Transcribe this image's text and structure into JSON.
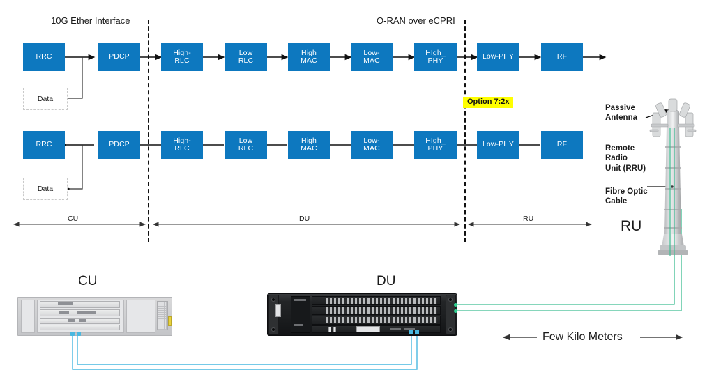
{
  "diagram": {
    "title_top_left": "10G Ether Interface",
    "title_top_right": "O-RAN over eCPRI",
    "split_marker_label": "Option 7:2x"
  },
  "downlink_chain": {
    "direction": "left-to-right",
    "blocks": [
      {
        "label": "RRC",
        "section": "CU"
      },
      {
        "label": "PDCP",
        "section": "CU"
      },
      {
        "label": "High-\nRLC",
        "section": "DU"
      },
      {
        "label": "Low\nRLC",
        "section": "DU"
      },
      {
        "label": "High\nMAC",
        "section": "DU"
      },
      {
        "label": "Low-\nMAC",
        "section": "DU"
      },
      {
        "label": "HIgh_\nPHY",
        "section": "DU"
      },
      {
        "label": "Low-PHY",
        "section": "RU"
      },
      {
        "label": "RF",
        "section": "RU"
      }
    ],
    "data_box": "Data"
  },
  "uplink_chain": {
    "direction": "right-to-left",
    "blocks": [
      {
        "label": "RRC",
        "section": "CU"
      },
      {
        "label": "PDCP",
        "section": "CU"
      },
      {
        "label": "High-\nRLC",
        "section": "DU"
      },
      {
        "label": "Low\nRLC",
        "section": "DU"
      },
      {
        "label": "High\nMAC",
        "section": "DU"
      },
      {
        "label": "Low-\nMAC",
        "section": "DU"
      },
      {
        "label": "HIgh_\nPHY",
        "section": "DU"
      },
      {
        "label": "Low-PHY",
        "section": "RU"
      },
      {
        "label": "RF",
        "section": "RU"
      }
    ],
    "data_box": "Data"
  },
  "scale_bar": {
    "segments": [
      {
        "label": "CU"
      },
      {
        "label": "DU"
      },
      {
        "label": "RU"
      }
    ]
  },
  "tower": {
    "callouts": [
      {
        "label": "Passive\nAntenna"
      },
      {
        "label": "Remote\nRadio\nUnit (RRU)"
      },
      {
        "label": "Fibre Optic\nCable"
      }
    ],
    "name": "RU"
  },
  "hardware": {
    "cu_label": "CU",
    "du_label": "DU",
    "distance_label": "Few Kilo Meters"
  },
  "colors": {
    "block_blue": "#0d78bf",
    "highlight_yellow": "#ffff00",
    "fibre_green": "#2fcf90",
    "copper_cyan": "#49b8e0",
    "text_dark": "#1b1b1b"
  }
}
